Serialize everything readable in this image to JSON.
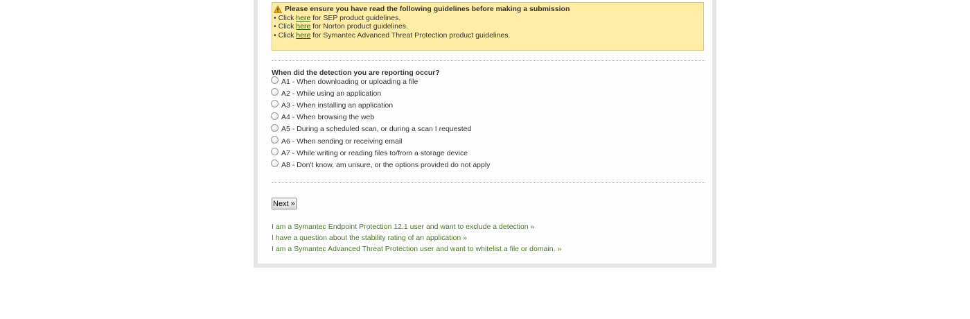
{
  "notice": {
    "heading": "Please ensure you have read the following guidelines before making a submission",
    "lines": [
      {
        "prefix": "• Click ",
        "link": "here",
        "suffix": " for SEP product guidelines."
      },
      {
        "prefix": "• Click ",
        "link": "here",
        "suffix": " for Norton product guidelines."
      },
      {
        "prefix": "• Click ",
        "link": "here",
        "suffix": " for Symantec Advanced Threat Protection product guidelines."
      }
    ],
    "icon": "warning-icon",
    "background_color": "#ffeda6"
  },
  "question": {
    "label": "When did the detection you are reporting occur?",
    "options": [
      "A1 - When downloading or uploading a file",
      "A2 - While using an application",
      "A3 - When installing an application",
      "A4 - When browsing the web",
      "A5 - During a scheduled scan, or during a scan I requested",
      "A6 - When sending or receiving email",
      "A7 - While writing or reading files to/from a storage device",
      "A8 - Don't know, am unsure, or the options provided do not apply"
    ]
  },
  "next_button": "Next »",
  "links": [
    "I am a Symantec Endpoint Protection 12.1 user and want to exclude a detection »",
    "I have a question about the stability rating of an application »",
    "I am a Symantec Advanced Threat Protection user and want to whitelist a file or domain. »"
  ],
  "colors": {
    "link": "#4c7a1e",
    "frame": "#e6e6e6"
  }
}
